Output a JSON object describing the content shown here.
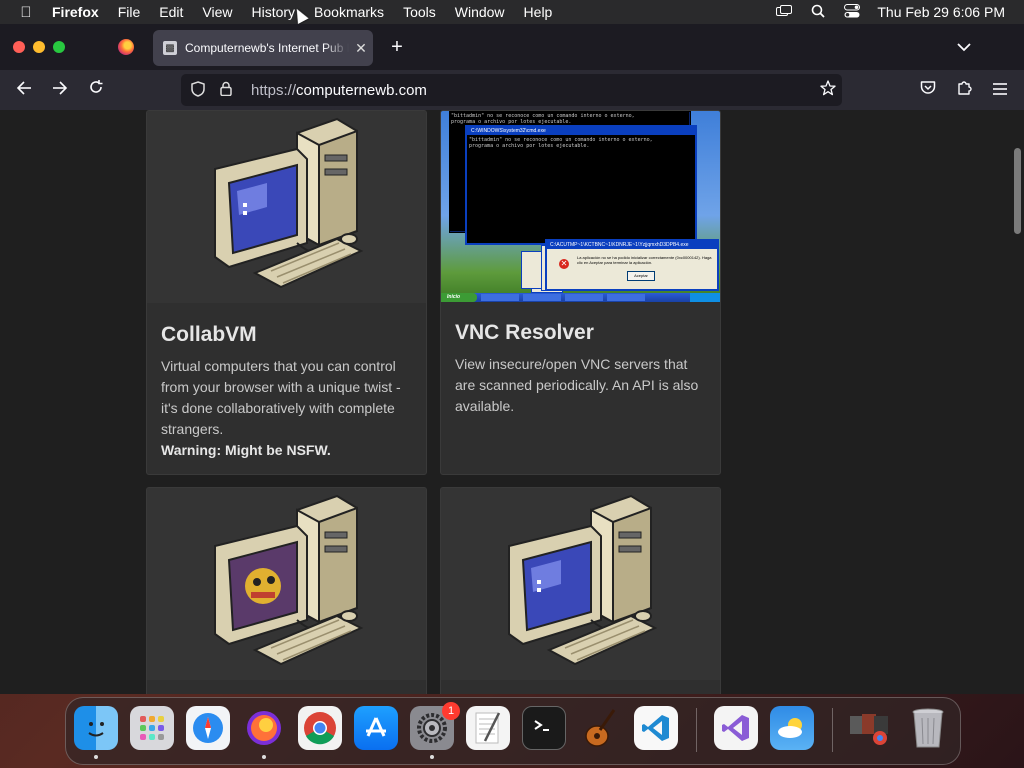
{
  "menubar": {
    "app_name": "Firefox",
    "items": [
      "File",
      "Edit",
      "View",
      "History",
      "Bookmarks",
      "Tools",
      "Window",
      "Help"
    ],
    "clock": "Thu Feb 29  6:06 PM"
  },
  "browser": {
    "active_tab_title": "Computernewb's Internet Pub H",
    "close_tab_glyph": "✕",
    "new_tab_glyph": "+",
    "list_tabs_glyph": "⌄",
    "url_scheme": "https://",
    "url_host": "computernewb.com"
  },
  "cards": [
    {
      "title": "CollabVM",
      "description": "Virtual computers that you can control from your browser with a unique twist - it's done collaboratively with complete strangers.",
      "warning": "Warning: Might be NSFW.",
      "image_icon": "retro-computer-icon"
    },
    {
      "title": "VNC Resolver",
      "description": "View insecure/open VNC servers that are scanned periodically. An API is also available.",
      "image_icon": "windows-xp-screenshot"
    },
    {
      "title": "",
      "description": "",
      "image_icon": "retro-computer-game-icon"
    },
    {
      "title": "",
      "description": "",
      "image_icon": "retro-computer-icon"
    }
  ],
  "screenshot_text": {
    "cmd_line1": "\"bittadmin\" no se reconoce como un comando interno o externo,",
    "cmd_line2": "programa o archivo por lotes ejecutable.",
    "cmd_window_title": "C:\\WINDOWS\\system32\\cmd.exe",
    "error_title": "C:\\ACUTMP~1\\KCTBNC~1\\KDNRJE~1\\YzjjqmxhD3DPB4.exe",
    "error_text": "La aplicación no se ha podido inicializar correctamente (0xc0000142). Haga clic en Aceptar para terminar la aplicación.",
    "error_button": "Aceptar",
    "start_label": "Inicio"
  },
  "dock": {
    "system_settings_badge": "1",
    "apps": [
      "finder",
      "launchpad",
      "safari",
      "firefox",
      "chrome",
      "app-store",
      "system-settings",
      "textedit",
      "terminal",
      "garageband",
      "vscode",
      "visual-studio",
      "weather",
      "downloads-stack",
      "trash"
    ]
  }
}
